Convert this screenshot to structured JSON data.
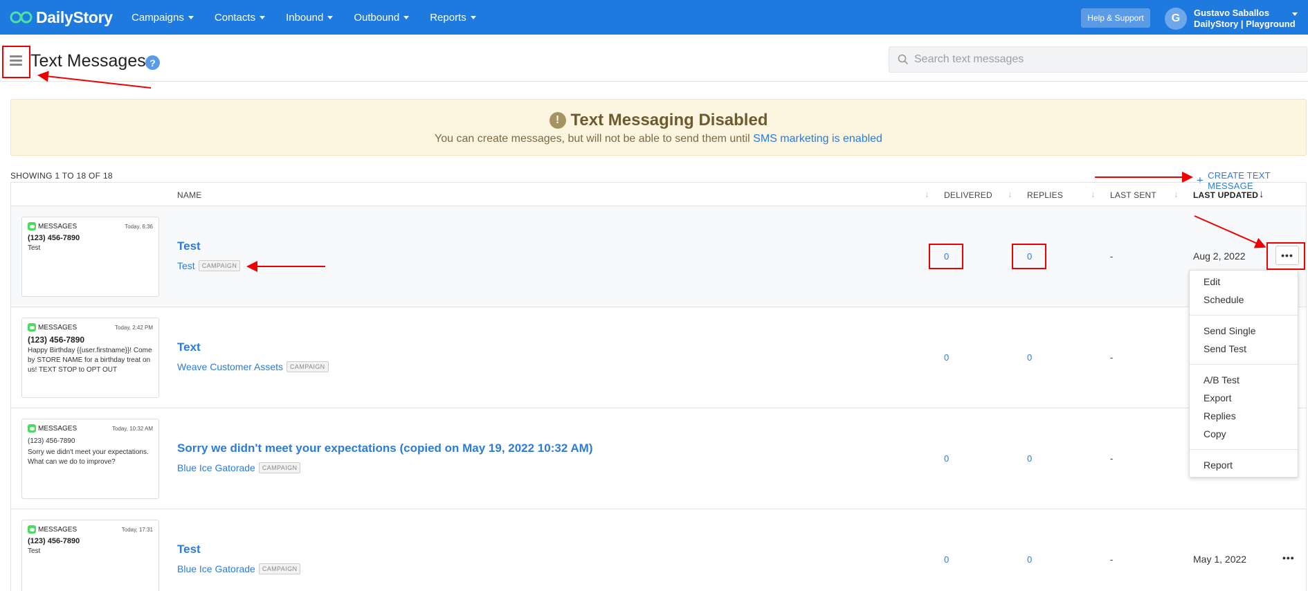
{
  "app": {
    "logo_text": "DailyStory",
    "nav": [
      "Campaigns",
      "Contacts",
      "Inbound",
      "Outbound",
      "Reports"
    ],
    "help_button": "Help & Support",
    "user": {
      "initial": "G",
      "name": "Gustavo Saballos",
      "org": "DailyStory | Playground"
    },
    "brand_color": "#1f7ae0"
  },
  "header": {
    "title": "Text Messages",
    "help_icon": "?",
    "search_placeholder": "Search text messages"
  },
  "banner": {
    "icon": "!",
    "title": "Text Messaging Disabled",
    "text": "You can create messages, but will not be able to send them until ",
    "link": "SMS marketing is enabled"
  },
  "list": {
    "showing": "SHOWING 1 TO 18 OF 18",
    "create_button": "CREATE TEXT MESSAGE",
    "columns": {
      "name": "NAME",
      "delivered": "DELIVERED",
      "replies": "REPLIES",
      "last_sent": "LAST SENT",
      "last_updated": "LAST UPDATED"
    },
    "badge": "CAMPAIGN",
    "rows": [
      {
        "preview": {
          "app": "MESSAGES",
          "time": "Today, 6:36",
          "phone": "(123) 456-7890",
          "body": "Test"
        },
        "name": "Test",
        "campaign": "Test",
        "delivered": "0",
        "replies": "0",
        "last_sent": "-",
        "last_updated": "Aug 2, 2022"
      },
      {
        "preview": {
          "app": "MESSAGES",
          "time": "Today, 2:42 PM",
          "phone": "(123) 456-7890",
          "body": "Happy Birthday {{user.firstname}}! Come by STORE NAME for a birthday treat on us! TEXT STOP to OPT OUT"
        },
        "name": "Text",
        "campaign": "Weave Customer Assets",
        "delivered": "0",
        "replies": "0",
        "last_sent": "-",
        "last_updated": ""
      },
      {
        "preview": {
          "app": "MESSAGES",
          "time": "Today, 10:32 AM",
          "phone": "(123) 456-7890",
          "body": "Sorry we didn't meet your expectations. What can we do to improve?"
        },
        "name": "Sorry we didn't meet your expectations (copied on May 19, 2022 10:32 AM)",
        "campaign": "Blue Ice Gatorade",
        "delivered": "0",
        "replies": "0",
        "last_sent": "-",
        "last_updated": ""
      },
      {
        "preview": {
          "app": "MESSAGES",
          "time": "Today, 17:31",
          "phone": "(123) 456-7890",
          "body": "Test"
        },
        "name": "Test",
        "campaign": "Blue Ice Gatorade",
        "delivered": "0",
        "replies": "0",
        "last_sent": "-",
        "last_updated": "May 1, 2022"
      }
    ]
  },
  "dropdown": {
    "items": [
      "Edit",
      "Schedule",
      "Send Single",
      "Send Test",
      "A/B Test",
      "Export",
      "Replies",
      "Copy",
      "Report"
    ]
  }
}
